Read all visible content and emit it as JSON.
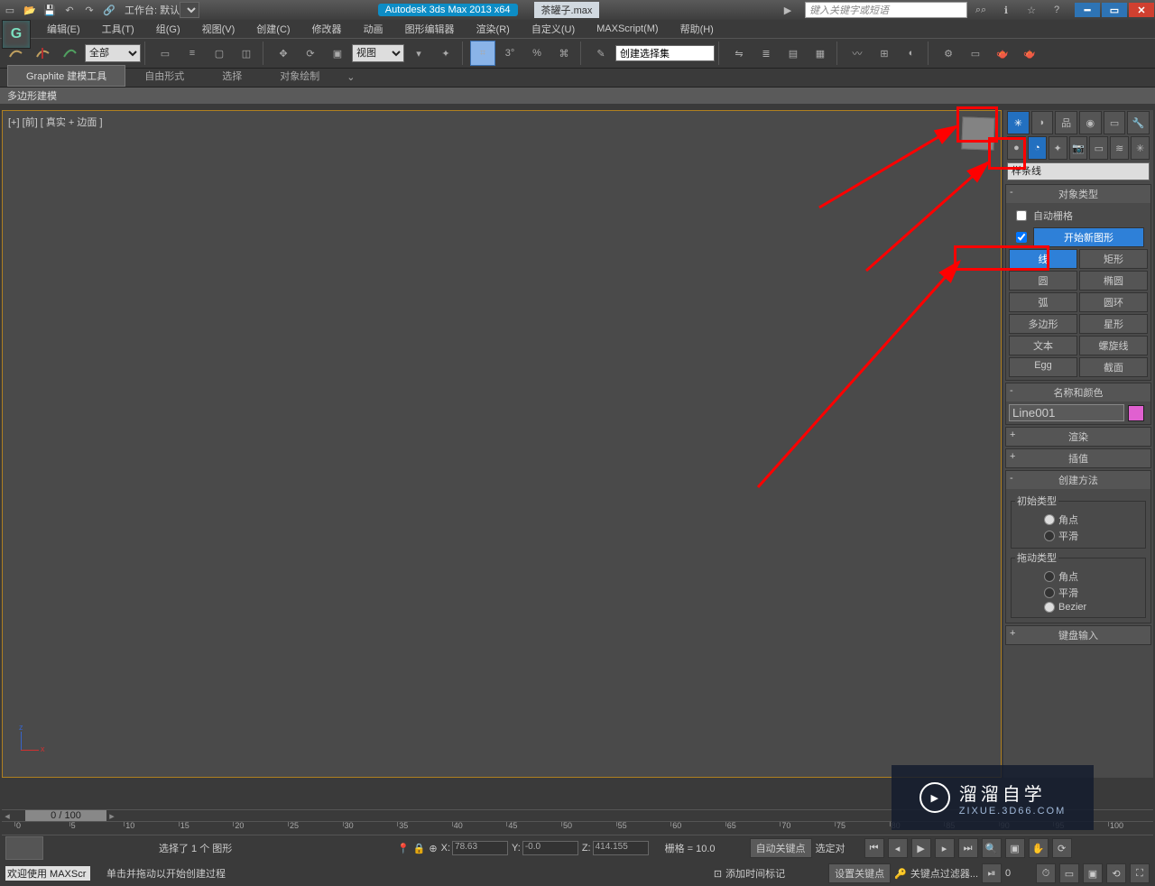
{
  "titlebar": {
    "workspace_label": "工作台: 默认",
    "product": "Autodesk 3ds Max  2013 x64",
    "file": "茶罐子.max",
    "search_placeholder": "键入关键字或短语"
  },
  "menu": [
    "编辑(E)",
    "工具(T)",
    "组(G)",
    "视图(V)",
    "创建(C)",
    "修改器",
    "动画",
    "图形编辑器",
    "渲染(R)",
    "自定义(U)",
    "MAXScript(M)",
    "帮助(H)"
  ],
  "toolbar": {
    "filter": "全部",
    "coord_dd": "视图",
    "named_sets": "创建选择集"
  },
  "ribbon": {
    "tabs": [
      "Graphite 建模工具",
      "自由形式",
      "选择",
      "对象绘制"
    ],
    "subtab": "多边形建模"
  },
  "viewport": {
    "label": "[+] [前] [ 真实 + 边面 ]"
  },
  "panel": {
    "category_dd": "样条线",
    "rollouts": {
      "obj_type": "对象类型",
      "auto_grid": "自动栅格",
      "start_new": "开始新图形",
      "buttons": [
        [
          "线",
          "矩形"
        ],
        [
          "圆",
          "椭圆"
        ],
        [
          "弧",
          "圆环"
        ],
        [
          "多边形",
          "星形"
        ],
        [
          "文本",
          "螺旋线"
        ],
        [
          "Egg",
          "截面"
        ]
      ],
      "name_color": "名称和颜色",
      "name_value": "Line001",
      "render": "渲染",
      "interp": "插值",
      "create_method": "创建方法",
      "init_type": "初始类型",
      "drag_type": "拖动类型",
      "corner": "角点",
      "smooth": "平滑",
      "bezier": "Bezier",
      "keyboard": "键盘输入"
    }
  },
  "timeline": {
    "slider": "0 / 100",
    "ticks": [
      0,
      5,
      10,
      15,
      20,
      25,
      30,
      35,
      40,
      45,
      50,
      55,
      60,
      65,
      70,
      75,
      80,
      85,
      90,
      95,
      100
    ]
  },
  "status": {
    "welcome": "欢迎使用  MAXScr",
    "line1": "选择了 1 个 图形",
    "line2": "单击并拖动以开始创建过程",
    "x": "78.63",
    "y": "-0.0",
    "z": "414.155",
    "grid": "栅格 = 10.0",
    "add_time": "添加时间标记",
    "auto_key": "自动关键点",
    "set_key": "设置关键点",
    "sel_label": "选定对",
    "key_filter": "关键点过滤器...",
    "frame": "0"
  },
  "watermark": {
    "title": "溜溜自学",
    "sub": "ZIXUE.3D66.COM"
  },
  "x_label": "X:",
  "y_label": "Y:",
  "z_label": "Z:"
}
